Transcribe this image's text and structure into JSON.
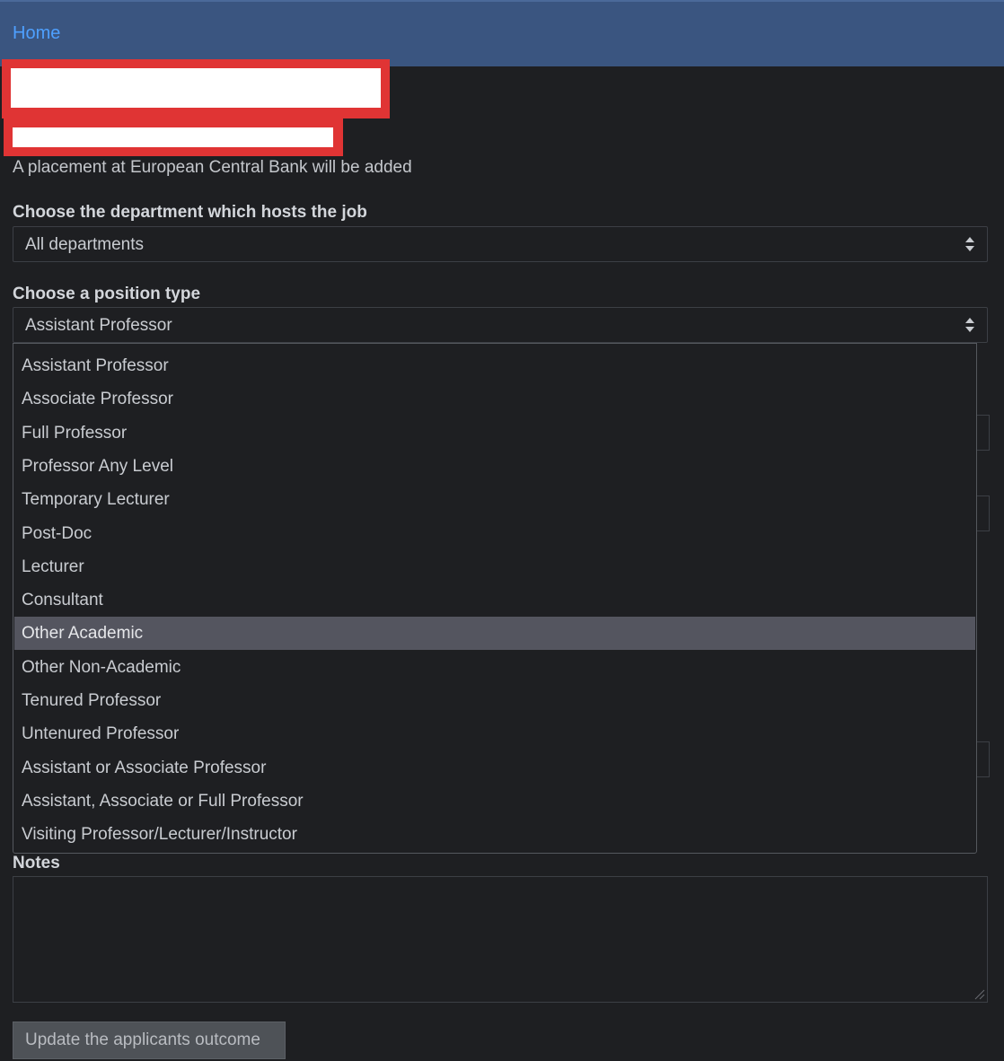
{
  "nav": {
    "home_label": "Home"
  },
  "info_text": "A placement at European Central Bank will be added",
  "department": {
    "label": "Choose the department which hosts the job",
    "selected": "All departments"
  },
  "position": {
    "label": "Choose a position type",
    "selected": "Assistant Professor",
    "options": [
      "Assistant Professor",
      "Associate Professor",
      "Full Professor",
      "Professor Any Level",
      "Temporary Lecturer",
      "Post-Doc",
      "Lecturer",
      "Consultant",
      "Other Academic",
      "Other Non-Academic",
      "Tenured Professor",
      "Untenured Professor",
      "Assistant or Associate Professor",
      "Assistant, Associate or Full Professor",
      "Visiting Professor/Lecturer/Instructor"
    ],
    "highlighted": "Other Academic"
  },
  "notes": {
    "label": "Notes",
    "value": ""
  },
  "submit": {
    "label": "Update the applicants outcome"
  },
  "colors": {
    "navbar": "#3a5580",
    "link": "#4ea0ff",
    "redaction": "#e03434",
    "highlight": "#54555f"
  }
}
